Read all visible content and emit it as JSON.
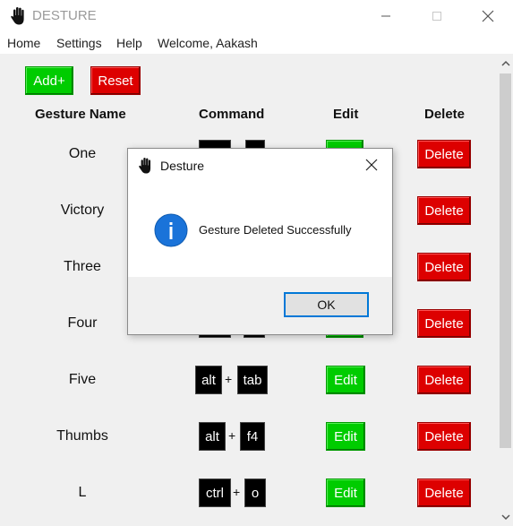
{
  "window": {
    "title": "DESTURE",
    "icon": "hand-icon"
  },
  "menu": {
    "items": [
      "Home",
      "Settings",
      "Help",
      "Welcome, Aakash"
    ]
  },
  "toolbar": {
    "add_label": "Add+",
    "reset_label": "Reset"
  },
  "table": {
    "headers": [
      "Gesture Name",
      "Command",
      "Edit",
      "Delete"
    ],
    "rows": [
      {
        "name": "One",
        "keys": [
          "",
          ""
        ],
        "edit": "",
        "delete": "Delete"
      },
      {
        "name": "Victory",
        "keys": [],
        "edit": "",
        "delete": "Delete"
      },
      {
        "name": "Three",
        "keys": [],
        "edit": "",
        "delete": "Delete"
      },
      {
        "name": "Four",
        "keys": [
          "",
          ""
        ],
        "edit": "",
        "delete": "Delete"
      },
      {
        "name": "Five",
        "keys": [
          "alt",
          "tab"
        ],
        "edit": "Edit",
        "delete": "Delete"
      },
      {
        "name": "Thumbs",
        "keys": [
          "alt",
          "f4"
        ],
        "edit": "Edit",
        "delete": "Delete"
      },
      {
        "name": "L",
        "keys": [
          "ctrl",
          "o"
        ],
        "edit": "Edit",
        "delete": "Delete"
      }
    ],
    "plus_sign": "+"
  },
  "dialog": {
    "title": "Desture",
    "message": "Gesture Deleted Successfully",
    "ok_label": "OK",
    "icon": "info-icon"
  },
  "colors": {
    "green": "#00cc00",
    "red": "#dd0000",
    "key_bg": "#000000",
    "accent": "#0078d7"
  }
}
